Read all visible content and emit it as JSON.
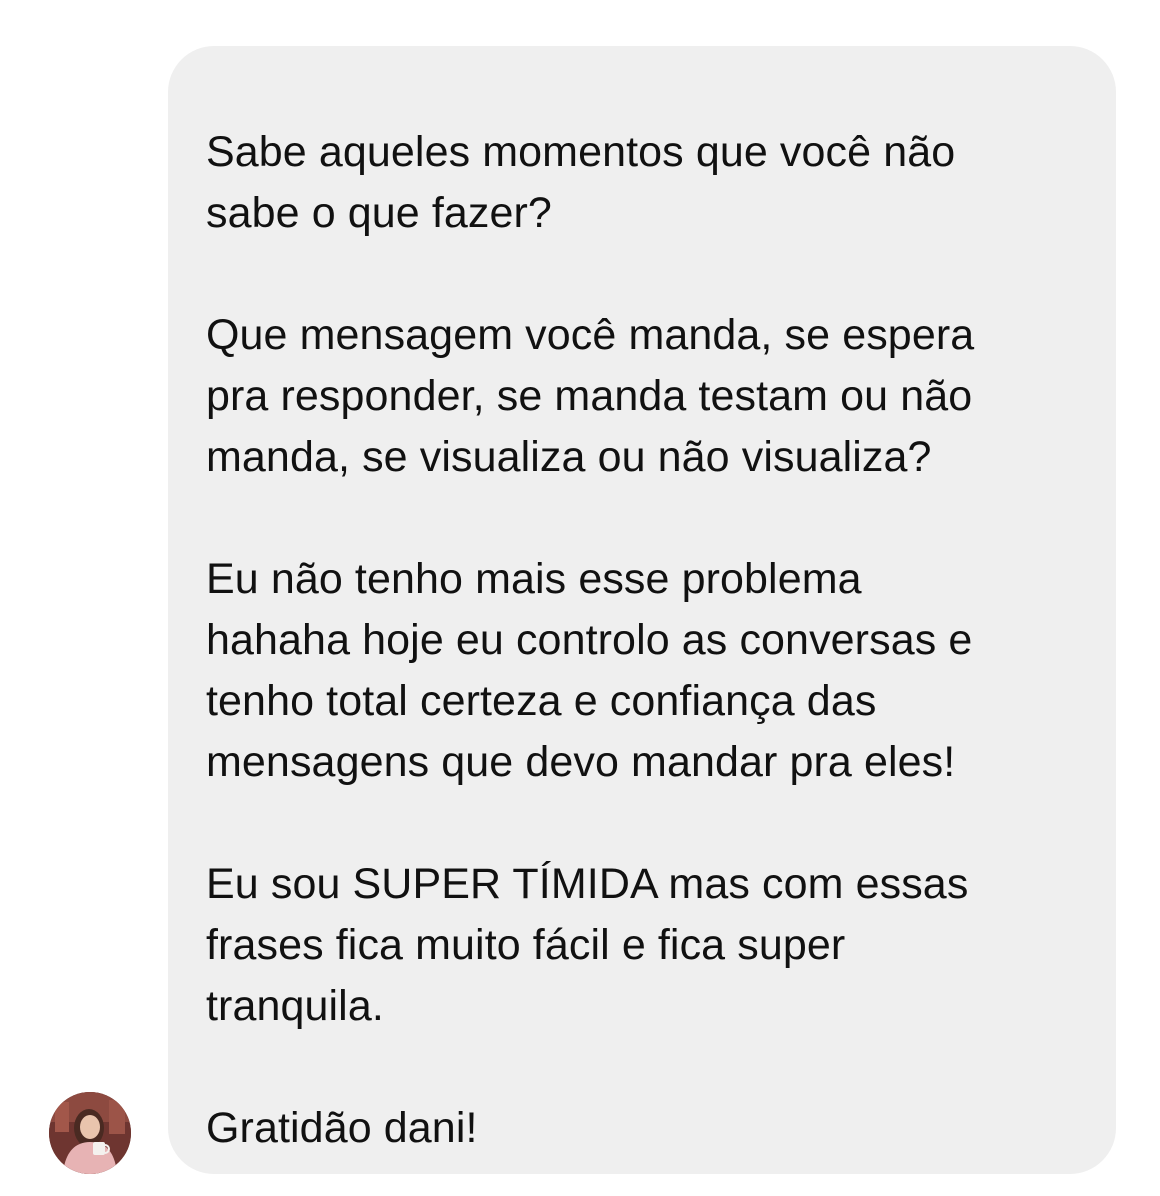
{
  "message": {
    "lines_1": [
      "Sabe aqueles momentos que você não",
      "sabe o que fazer?"
    ],
    "lines_2": [
      "Que mensagem você manda, se espera",
      "pra responder, se manda testam ou não",
      "manda, se visualiza ou não visualiza?"
    ],
    "lines_3": [
      "Eu não tenho mais esse problema",
      "hahaha hoje eu controlo as conversas e",
      "tenho total certeza e confiança das",
      "mensagens que devo mandar pra eles!"
    ],
    "lines_4": [
      "Eu sou SUPER TÍMIDA mas com essas",
      "frases fica muito fácil e fica super",
      "tranquila."
    ],
    "lines_5": [
      "Gratidão dani!"
    ]
  },
  "avatar": {
    "icon": "user-avatar-photo"
  },
  "colors": {
    "bubble_background": "#efefef",
    "text": "#111111",
    "page_background": "#ffffff"
  }
}
